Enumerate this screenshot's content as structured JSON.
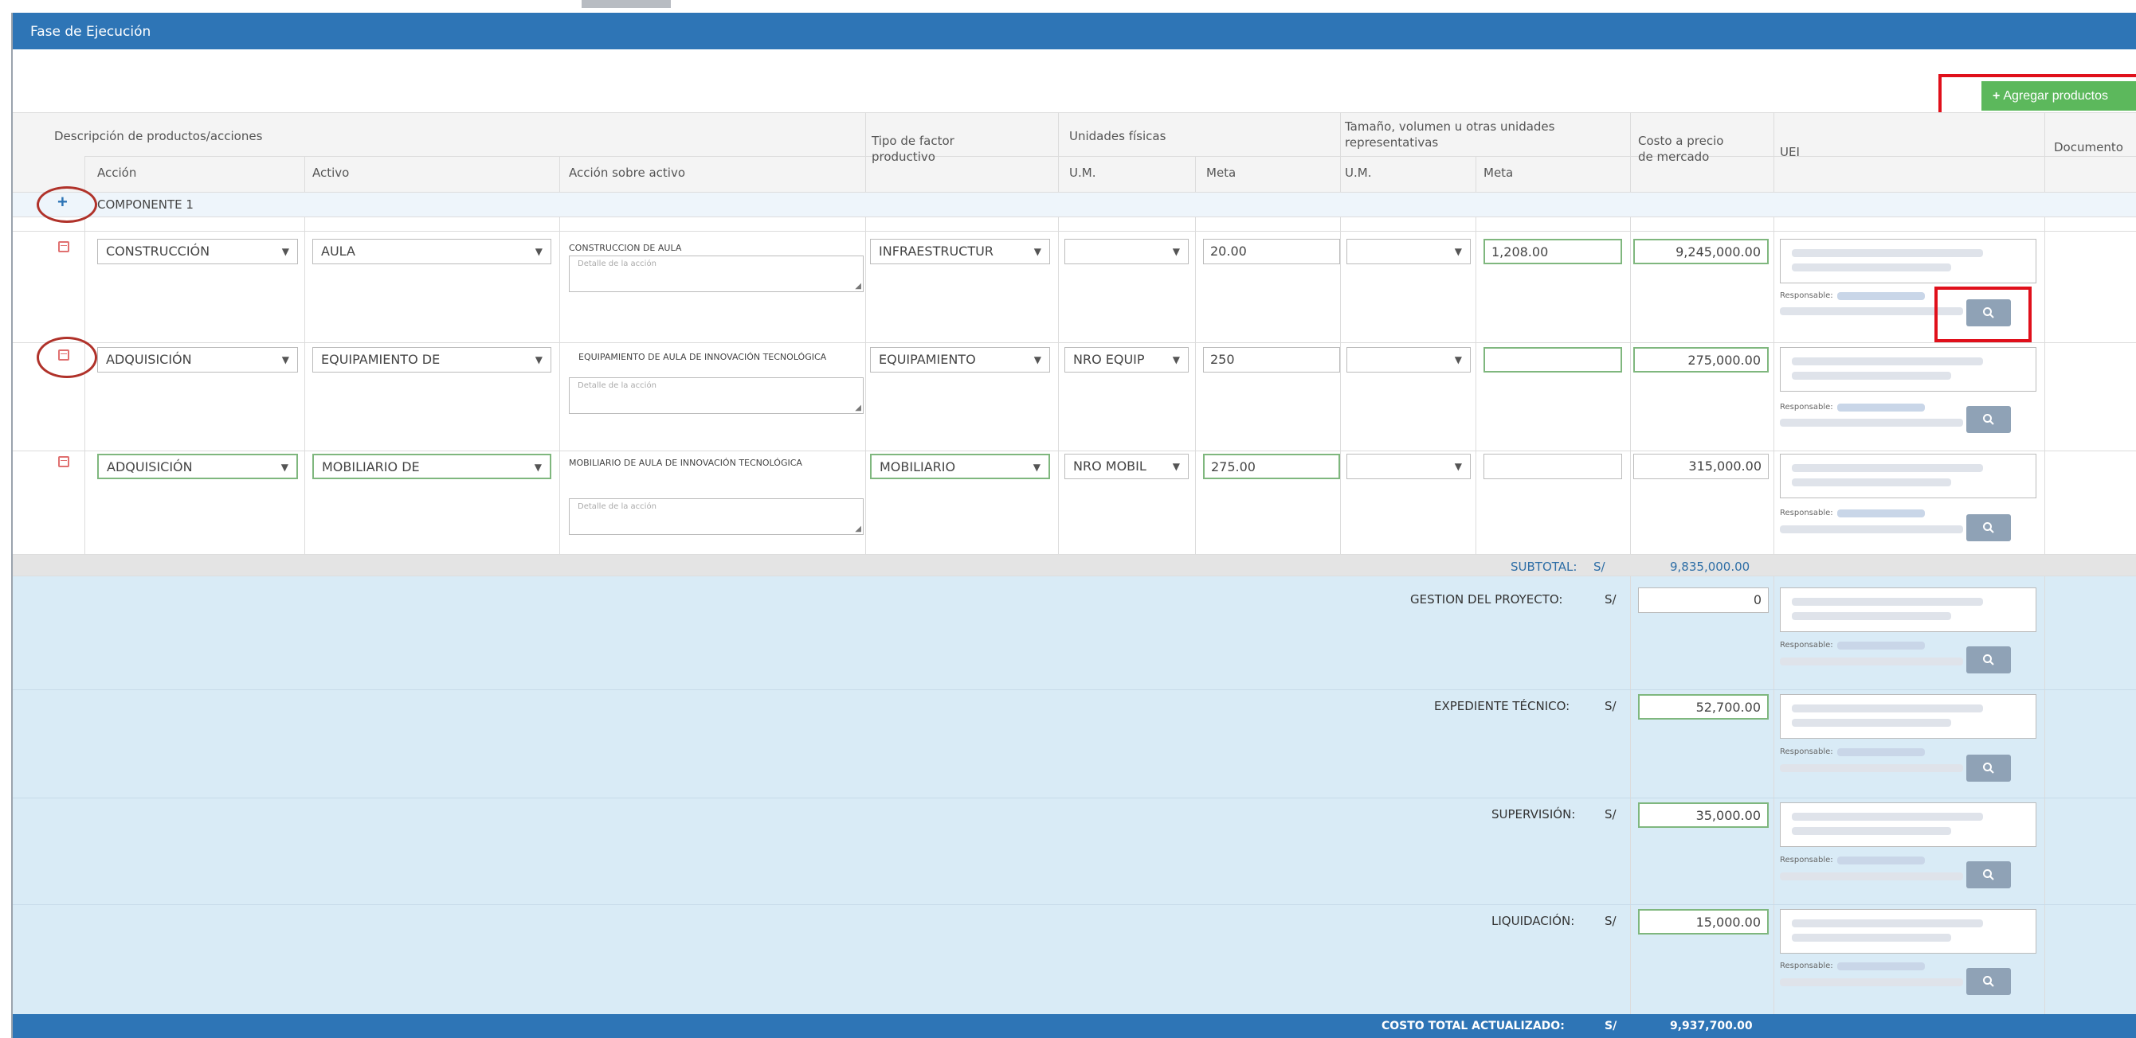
{
  "panel": {
    "title": "Fase de Ejecución"
  },
  "toolbar": {
    "add_label": "Agregar productos"
  },
  "headers": {
    "group_description": "Descripción de productos/acciones",
    "accion": "Acción",
    "activo": "Activo",
    "accion_sobre_activo": "Acción sobre activo",
    "tipo_factor_line1": "Tipo de factor",
    "tipo_factor_line2": "productivo",
    "unidades_fisicas": "Unidades físicas",
    "um": "U.M.",
    "meta": "Meta",
    "tamano_line1": "Tamaño, volumen u otras unidades",
    "tamano_line2": "representativas",
    "um2": "U.M.",
    "meta2": "Meta",
    "costo_line1": "Costo a precio",
    "costo_line2": "de mercado",
    "uei": "UEI",
    "documento": "Documento"
  },
  "component": {
    "label": "COMPONENTE 1"
  },
  "rows": [
    {
      "accion": "CONSTRUCCIÓN",
      "activo": "AULA",
      "accion_sobre_activo": "CONSTRUCCION DE AULA",
      "detalle_placeholder": "Detalle de la acción",
      "tipo_factor": "INFRAESTRUCTUR",
      "um": "",
      "meta": "20.00",
      "um2": "",
      "meta2": "1,208.00",
      "costo": "9,245,000.00",
      "responsable_label": "Responsable:"
    },
    {
      "accion": "ADQUISICIÓN",
      "activo": "EQUIPAMIENTO DE",
      "accion_sobre_activo": "EQUIPAMIENTO DE AULA DE INNOVACIÓN TECNOLÓGICA",
      "detalle_placeholder": "Detalle de la acción",
      "tipo_factor": "EQUIPAMIENTO",
      "um": "NRO EQUIP",
      "meta": "250",
      "um2": "",
      "meta2": "",
      "costo": "275,000.00",
      "responsable_label": "Responsable:"
    },
    {
      "accion": "ADQUISICIÓN",
      "activo": "MOBILIARIO DE",
      "accion_sobre_activo": "MOBILIARIO DE AULA DE INNOVACIÓN TECNOLÓGICA",
      "detalle_placeholder": "Detalle de la acción",
      "tipo_factor": "MOBILIARIO",
      "um": "NRO MOBIL",
      "meta": "275.00",
      "um2": "",
      "meta2": "",
      "costo": "315,000.00",
      "responsable_label": "Responsable:"
    }
  ],
  "summary": {
    "subtotal_label": "SUBTOTAL:",
    "currency": "S/",
    "subtotal_value": "9,835,000.00",
    "gestion_label": "GESTION DEL PROYECTO:",
    "gestion_value": "0",
    "expediente_label": "EXPEDIENTE TÉCNICO:",
    "expediente_value": "52,700.00",
    "supervision_label": "SUPERVISIÓN:",
    "supervision_value": "35,000.00",
    "liquidacion_label": "LIQUIDACIÓN:",
    "liquidacion_value": "15,000.00",
    "responsable_label": "Responsable:",
    "total_label": "COSTO TOTAL ACTUALIZADO:",
    "total_value": "9,937,700.00"
  },
  "colors": {
    "header_blue": "#2e75b6",
    "add_green": "#5cb85c",
    "highlight_red": "#e0101b",
    "summary_bg": "#d9ebf6"
  },
  "icons": {
    "add": "plus-icon",
    "delete": "trash-icon",
    "search": "search-icon",
    "dropdown": "chevron-down-icon"
  }
}
